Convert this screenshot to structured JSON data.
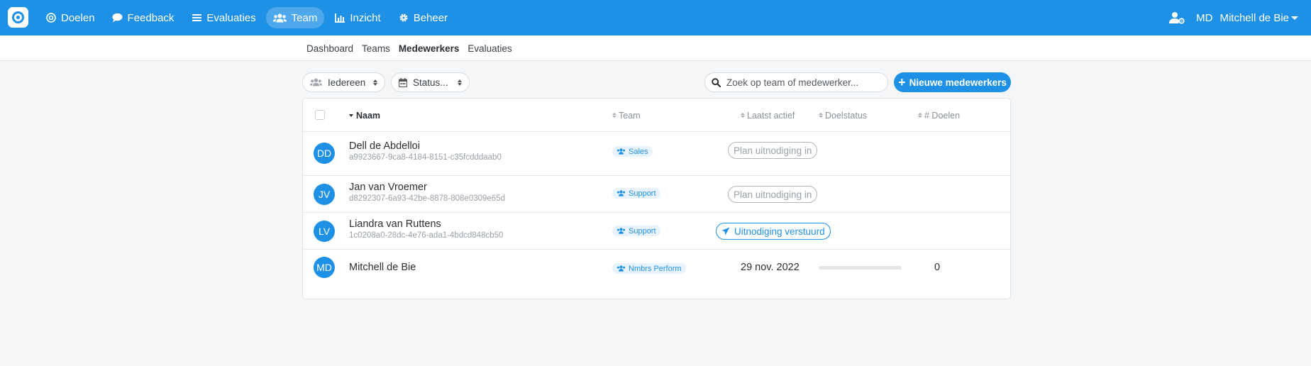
{
  "nav": {
    "items": [
      {
        "label": "Doelen",
        "icon": "target-icon"
      },
      {
        "label": "Feedback",
        "icon": "chat-icon"
      },
      {
        "label": "Evaluaties",
        "icon": "list-icon"
      },
      {
        "label": "Team",
        "icon": "users-icon",
        "active": true
      },
      {
        "label": "Inzicht",
        "icon": "chart-icon"
      },
      {
        "label": "Beheer",
        "icon": "gear-icon"
      }
    ],
    "user_initials": "MD",
    "user_name": "Mitchell de Bie"
  },
  "subnav": {
    "items": [
      "Dashboard",
      "Teams",
      "Medewerkers",
      "Evaluaties"
    ],
    "active": "Medewerkers"
  },
  "filters": {
    "scope": "Iedereen",
    "status": "Status..."
  },
  "search": {
    "placeholder": "Zoek op team of medewerker..."
  },
  "new_button": {
    "label": "Nieuwe medewerkers"
  },
  "table": {
    "columns": {
      "naam": "Naam",
      "team": "Team",
      "laatst_actief": "Laatst actief",
      "doelstatus": "Doelstatus",
      "doelen": "# Doelen"
    },
    "rows": [
      {
        "initials": "DD",
        "name": "Dell de Abdelloi",
        "id": "a9923667-9ca8-4184-8151-c35fcdddaab0",
        "team": "Sales",
        "status": "Plan uitnodiging in",
        "status_type": "plan",
        "last_active": "",
        "goals": ""
      },
      {
        "initials": "JV",
        "name": "Jan van Vroemer",
        "id": "d8292307-6a93-42be-8878-808e0309e65d",
        "team": "Support",
        "status": "Plan uitnodiging in",
        "status_type": "plan",
        "last_active": "",
        "goals": ""
      },
      {
        "initials": "LV",
        "name": "Liandra van Ruttens",
        "id": "1c0208a0-28dc-4e76-ada1-4bdcd848cb50",
        "team": "Support",
        "status": "Uitnodiging verstuurd",
        "status_type": "sent",
        "last_active": "",
        "goals": ""
      },
      {
        "initials": "MD",
        "name": "Mitchell de Bie",
        "id": "",
        "team": "Nmbrs Perform",
        "status": "",
        "status_type": "progress",
        "progress": 0,
        "last_active": "29 nov. 2022",
        "goals": "0"
      }
    ]
  },
  "colors": {
    "primary": "#1e90e6",
    "background": "#f4f6f8"
  }
}
